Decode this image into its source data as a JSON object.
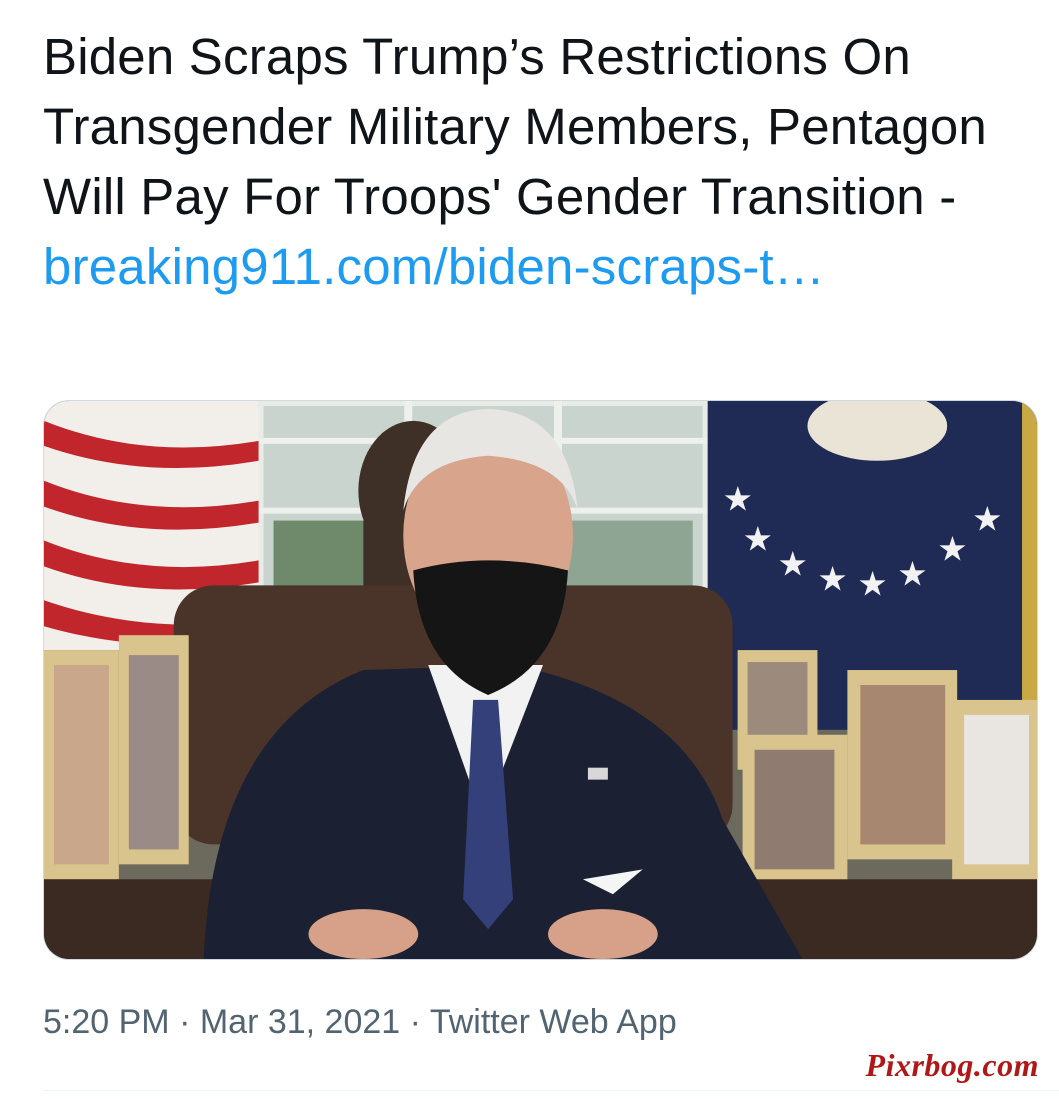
{
  "tweet": {
    "text": "Biden Scraps Trump’s Restrictions On Transgender Military Members, Pentagon Will Pay For Troops' Gender Transition - ",
    "link": "breaking911.com/biden-scraps-t…"
  },
  "meta": {
    "time": "5:20 PM",
    "sep1": " · ",
    "date": "Mar 31, 2021",
    "sep2": " · ",
    "app": "Twitter Web App"
  },
  "watermark": {
    "text": "Pixrbog.com"
  },
  "colors": {
    "text": "#0f1419",
    "link": "#1d9bf0",
    "meta": "#536471",
    "watermark": "#b01818"
  }
}
